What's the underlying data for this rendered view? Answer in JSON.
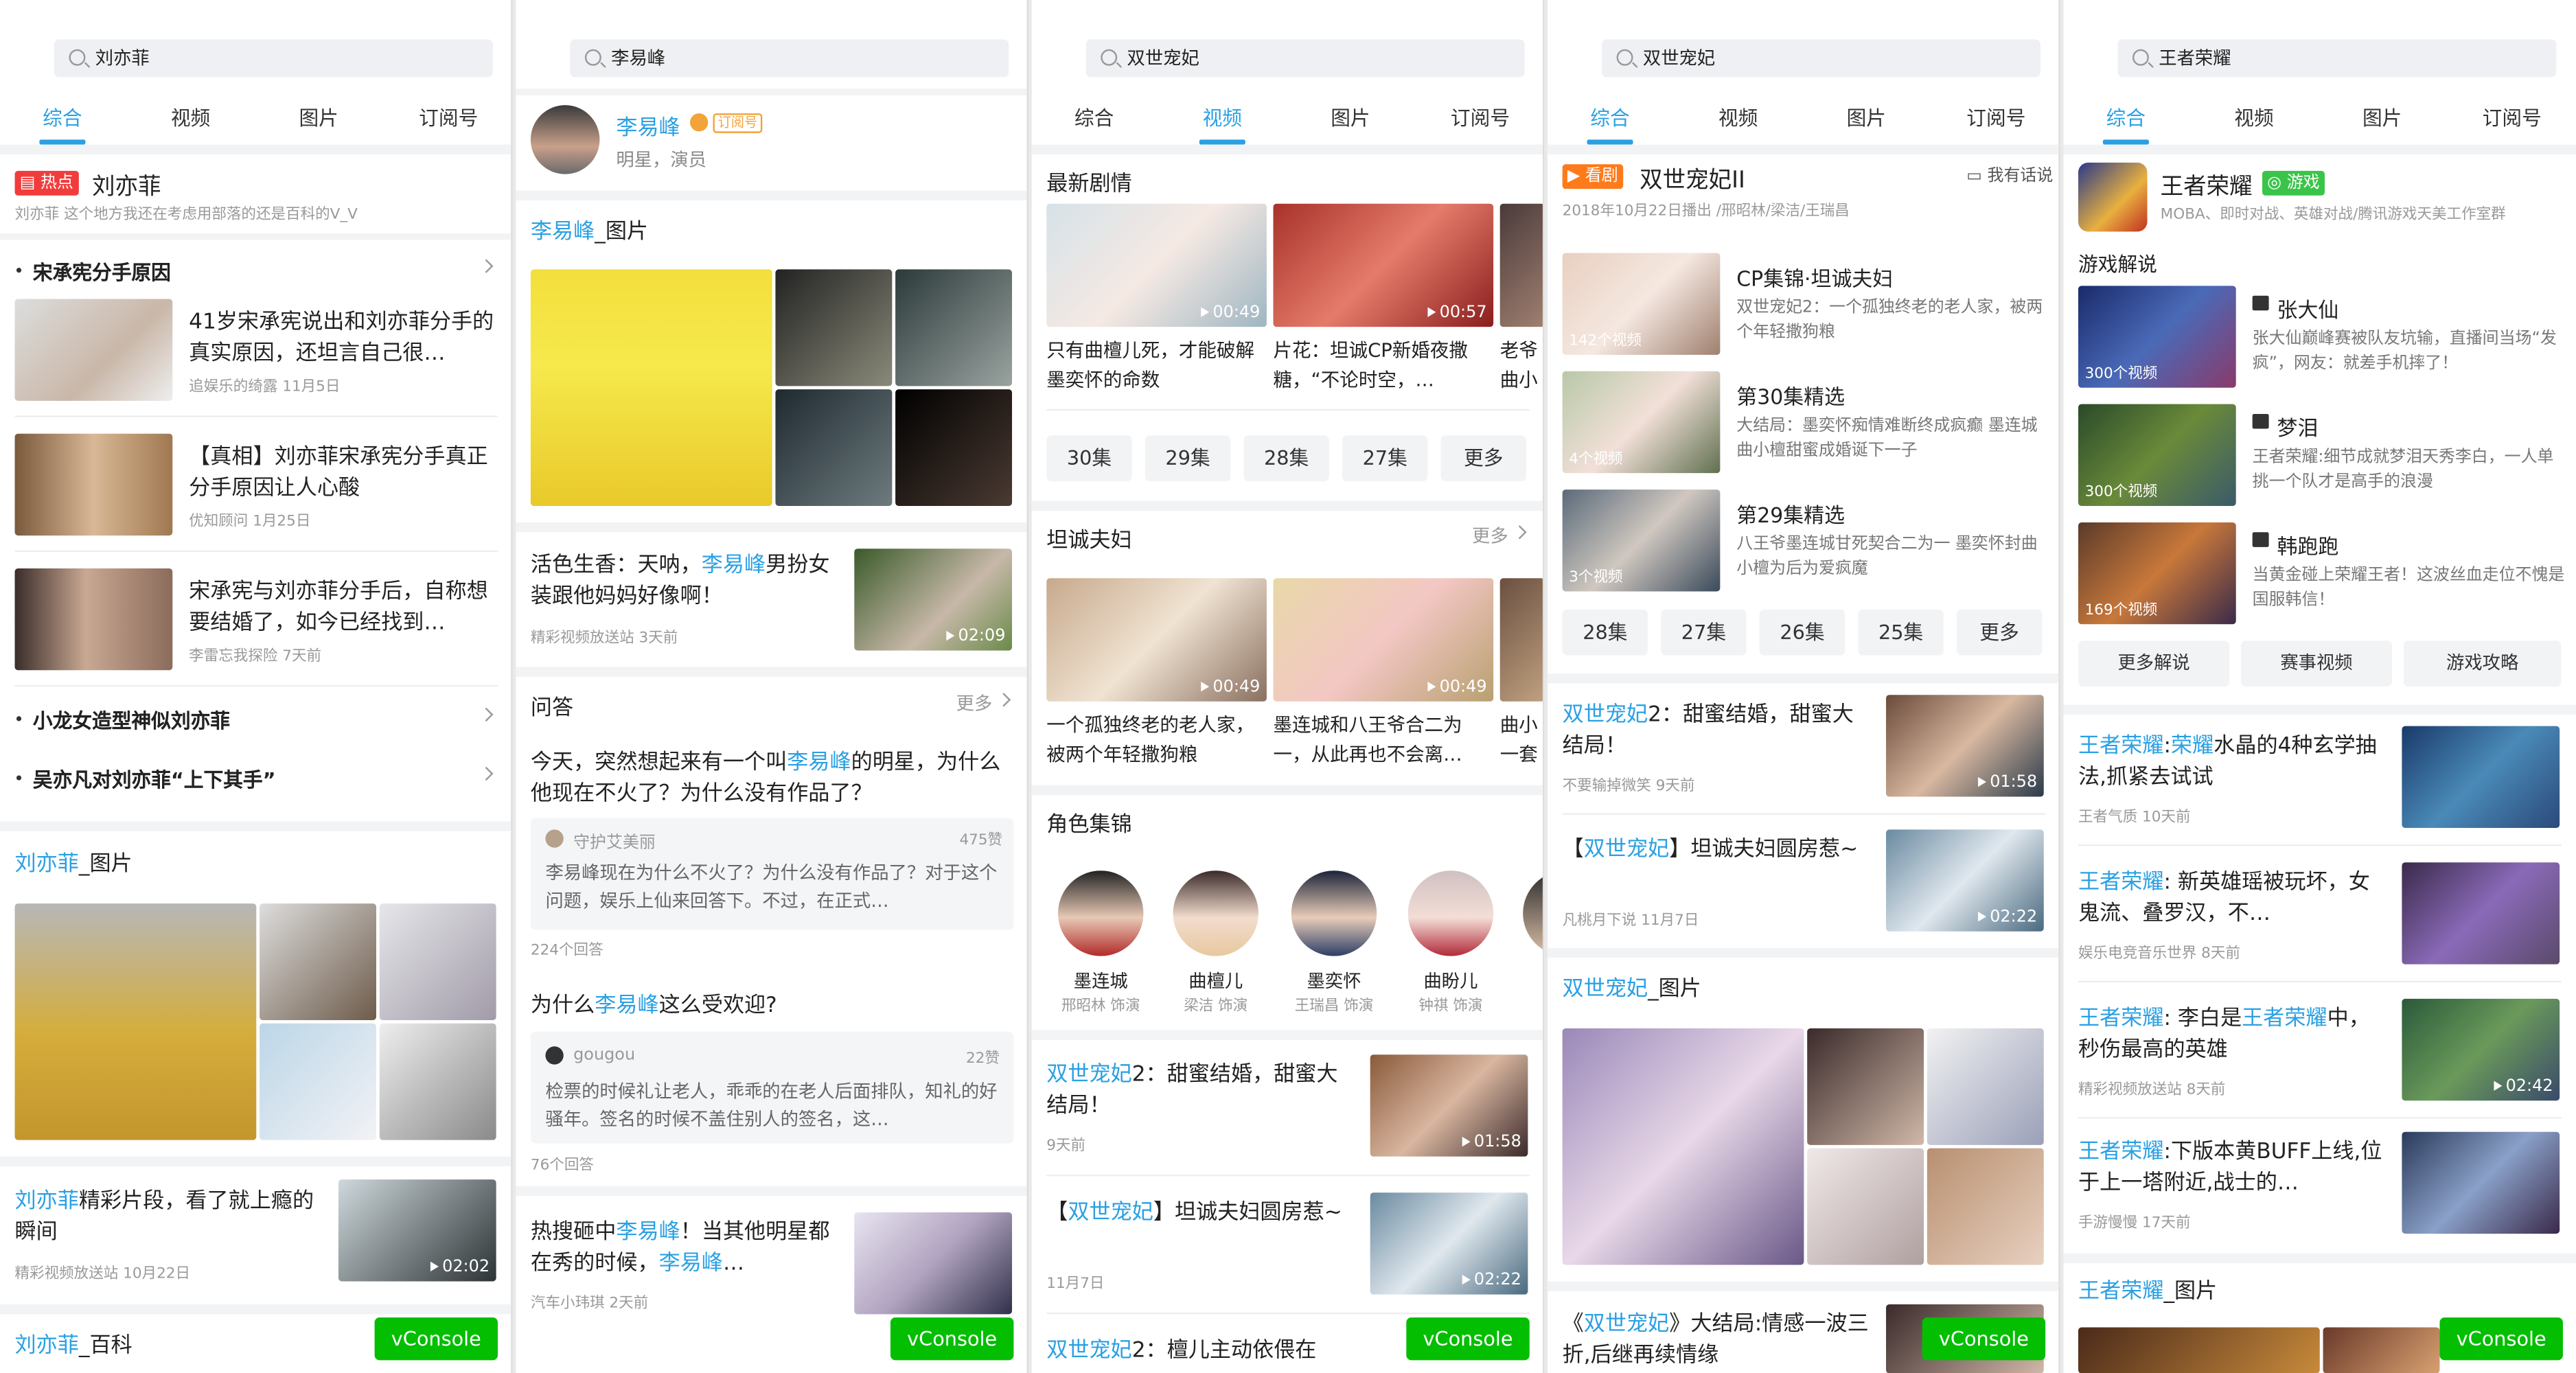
{
  "colors": {
    "accent": "#2aa0e3",
    "hot": "#f23c3c",
    "vconsole": "#04be02",
    "orange": "#ff7a1a",
    "green": "#3ac44a"
  },
  "common": {
    "tabs": [
      "综合",
      "视频",
      "图片",
      "订阅号"
    ],
    "vconsole": "vConsole",
    "more": "更多"
  },
  "p1": {
    "query": "刘亦菲",
    "hot_badge": "热点",
    "title": "刘亦菲",
    "subtitle": "刘亦菲 这个地方我还在考虑用部落的还是百科的V_V",
    "topic1": "宋承宪分手原因",
    "news": [
      {
        "title": "41岁宋承宪说出和刘亦菲分手的真实原因，还坦言自己很…",
        "meta": "追娱乐的绮露 11月5日"
      },
      {
        "title": "【真相】刘亦菲宋承宪分手真正分手原因让人心酸",
        "meta": "优知顾问 1月25日"
      },
      {
        "title": "宋承宪与刘亦菲分手后，自称想要结婚了，如今已经找到…",
        "meta": "李雷忘我探险 7天前"
      }
    ],
    "topic2": "小龙女造型神似刘亦菲",
    "topic3": "吴亦凡对刘亦菲“上下其手”",
    "pic_title_hl": "刘亦菲",
    "pic_title_rest": "_图片",
    "video_title_hl": "刘亦菲",
    "video_title_rest": "精彩片段，看了就上瘾的瞬间",
    "video_meta": "精彩视频放送站 10月22日",
    "video_dur": "02:02",
    "baike_hl": "刘亦菲",
    "baike_rest": "_百科"
  },
  "p2": {
    "query": "李易峰",
    "name": "李易峰",
    "sub_tag": "订阅号",
    "desc": "明星，演员",
    "pic_title_hl": "李易峰",
    "pic_title_rest": "_图片",
    "art1_pre": "活色生香：天呐，",
    "art1_hl": "李易峰",
    "art1_post": "男扮女装跟他妈妈好像啊！",
    "art1_meta": "精彩视频放送站 3天前",
    "art1_dur": "02:09",
    "qa_title": "问答",
    "q1_pre": "今天，突然想起来有一个叫",
    "q1_hl": "李易峰",
    "q1_post": "的明星，为什么他现在不火了？为什么没有作品了？",
    "a1_user": "守护艾美丽",
    "a1_likes": "475赞",
    "a1_text": "李易峰现在为什么不火了？为什么没有作品了？对于这个问题，娱乐上仙来回答下。不过，在正式…",
    "a1_count": "224个回答",
    "q2_pre": "为什么",
    "q2_hl": "李易峰",
    "q2_post": "这么受欢迎?",
    "a2_user": "gougou",
    "a2_likes": "22赞",
    "a2_text": "检票的时候礼让老人，乖乖的在老人后面排队，知礼的好骚年。签名的时候不盖住别人的签名，这…",
    "a2_count": "76个回答",
    "art2_pre": "热搜砸中",
    "art2_hl": "李易峰",
    "art2_mid": "！当其他明星都在秀的时候，",
    "art2_hl2": "李易峰",
    "art2_post": "…",
    "art2_meta": "汽车小玮琪 2天前"
  },
  "p3": {
    "query": "双世宠妃",
    "latest": "最新剧情",
    "latest_items": [
      {
        "title": "只有曲檀儿死，才能破解墨奕怀的命数",
        "dur": "00:49"
      },
      {
        "title": "片花：坦诚CP新婚夜撒糖，“不论时空，…",
        "dur": "00:57"
      },
      {
        "title": "老爷曲小",
        "dur": ""
      }
    ],
    "eps": [
      "30集",
      "29集",
      "28集",
      "27集",
      "更多"
    ],
    "couple": "坦诚夫妇",
    "couple_items": [
      {
        "title": "一个孤独终老的老人家，被两个年轻撒狗粮",
        "dur": "00:49"
      },
      {
        "title": "墨连城和八王爷合二为一，从此再也不会离…",
        "dur": "00:49"
      },
      {
        "title": "曲小一套",
        "dur": ""
      }
    ],
    "roles_title": "角色集锦",
    "roles": [
      {
        "name": "墨连城",
        "actor": "邢昭林 饰演"
      },
      {
        "name": "曲檀儿",
        "actor": "梁洁 饰演"
      },
      {
        "name": "墨奕怀",
        "actor": "王瑞昌 饰演"
      },
      {
        "name": "曲盼儿",
        "actor": "钟祺 饰演"
      },
      {
        "name": "",
        "actor": ""
      }
    ],
    "a1_hl": "双世宠妃",
    "a1_post": "2：甜蜜结婚，甜蜜大结局！",
    "a1_meta": "9天前",
    "a1_dur": "01:58",
    "a2_pre": "【",
    "a2_hl": "双世宠妃",
    "a2_post": "】坦诚夫妇圆房惹~",
    "a2_meta": "11月7日",
    "a2_dur": "02:22",
    "a3_hl": "双世宠妃",
    "a3_post": "2：檀儿主动依偎在"
  },
  "p4": {
    "query": "双世宠妃",
    "badge": "看剧",
    "title": "双世宠妃II",
    "talk": "我有话说",
    "info": "2018年10月22日播出 /邢昭林/梁洁/王瑞昌",
    "items": [
      {
        "title": "CP集锦·坦诚夫妇",
        "desc": "双世宠妃2：一个孤独终老的老人家，被两个年轻撒狗粮",
        "count": "142个视频"
      },
      {
        "title": "第30集精选",
        "desc": "大结局：墨奕怀痴情难断终成疯癫 墨连城曲小檀甜蜜成婚诞下一子",
        "count": "4个视频"
      },
      {
        "title": "第29集精选",
        "desc": "八王爷墨连城甘死契合二为一 墨奕怀封曲小檀为后为爱疯魔",
        "count": "3个视频"
      }
    ],
    "eps": [
      "28集",
      "27集",
      "26集",
      "25集",
      "更多"
    ],
    "a1_hl": "双世宠妃",
    "a1_post": "2：甜蜜结婚，甜蜜大结局！",
    "a1_meta": "不要输掉微笑 9天前",
    "a1_dur": "01:58",
    "a2_pre": "【",
    "a2_hl": "双世宠妃",
    "a2_post": "】坦诚夫妇圆房惹~",
    "a2_meta": "凡桃月下说 11月7日",
    "a2_dur": "02:22",
    "pic_hl": "双世宠妃",
    "pic_rest": "_图片",
    "a3_pre": "《",
    "a3_hl": "双世宠妃",
    "a3_post": "》大结局:情感一波三折,后继再续情缘"
  },
  "p5": {
    "query": "王者荣耀",
    "title": "王者荣耀",
    "badge": "游戏",
    "desc": "MOBA、即时对战、英雄对战/腾讯游戏天美工作室群",
    "section": "游戏解说",
    "casters": [
      {
        "name": "张大仙",
        "desc": "张大仙巅峰赛被队友坑输，直播间当场“发疯”，网友：就差手机摔了！",
        "count": "300个视频"
      },
      {
        "name": "梦泪",
        "desc": "王者荣耀:细节成就梦泪天秀李白，一人单挑一个队才是高手的浪漫",
        "count": "300个视频"
      },
      {
        "name": "韩跑跑",
        "desc": "当黄金碰上荣耀王者！这波丝血走位不愧是国服韩信！",
        "count": "169个视频"
      }
    ],
    "btns": [
      "更多解说",
      "赛事视频",
      "游戏攻略"
    ],
    "arts": [
      {
        "hl": "王者荣耀",
        "mid": ":",
        "hl2": "荣耀",
        "post": "水晶的4种玄学抽法,抓紧去试试",
        "meta": "王者气质 10天前",
        "dur": ""
      },
      {
        "hl": "王者荣耀",
        "mid": "",
        "hl2": "",
        "post": ": 新英雄瑶被玩坏，女鬼流、叠罗汉，不…",
        "meta": "娱乐电竞音乐世界 8天前",
        "dur": ""
      },
      {
        "hl": "王者荣耀",
        "mid": ": 李白是",
        "hl2": "王者荣耀",
        "post": "中，秒伤最高的英雄",
        "meta": "精彩视频放送站 8天前",
        "dur": "02:42"
      },
      {
        "hl": "王者荣耀",
        "mid": "",
        "hl2": "",
        "post": ":下版本黄BUFF上线,位于上一塔附近,战士的…",
        "meta": "手游慢慢 17天前",
        "dur": ""
      }
    ],
    "pic_hl": "王者荣耀",
    "pic_rest": "_图片"
  }
}
